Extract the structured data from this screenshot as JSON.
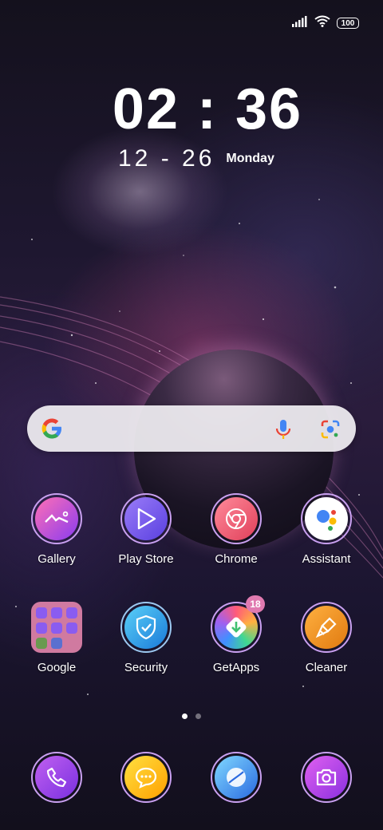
{
  "status_bar": {
    "battery_level": "100",
    "signal_icon": "signal-icon",
    "wifi_icon": "wifi-icon"
  },
  "lock_clock": {
    "time": "02 : 36",
    "date": "12 - 26",
    "day": "Monday"
  },
  "search": {
    "google_icon": "google-g-icon",
    "mic_icon": "mic-icon",
    "lens_icon": "lens-icon"
  },
  "apps_row1": [
    {
      "label": "Gallery",
      "icon": "gallery-icon"
    },
    {
      "label": "Play Store",
      "icon": "play-store-icon"
    },
    {
      "label": "Chrome",
      "icon": "chrome-icon"
    },
    {
      "label": "Assistant",
      "icon": "assistant-icon"
    }
  ],
  "apps_row2": [
    {
      "label": "Google",
      "icon": "google-folder-icon"
    },
    {
      "label": "Security",
      "icon": "security-icon"
    },
    {
      "label": "GetApps",
      "icon": "getapps-icon",
      "badge": "18"
    },
    {
      "label": "Cleaner",
      "icon": "cleaner-icon"
    }
  ],
  "page_indicator": {
    "pages": 2,
    "active": 1
  },
  "dock": [
    {
      "icon": "phone-icon"
    },
    {
      "icon": "messages-icon"
    },
    {
      "icon": "browser-icon"
    },
    {
      "icon": "camera-icon"
    }
  ],
  "colors": {
    "accent_pink": "#e07ab0",
    "icon_ring": "#c9a0f0"
  }
}
